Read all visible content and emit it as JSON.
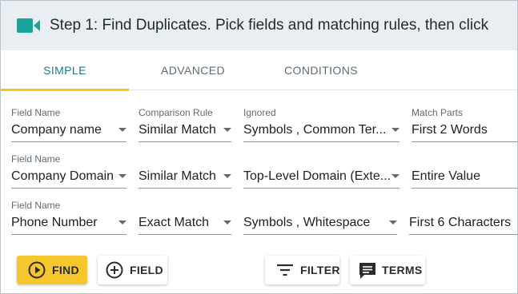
{
  "header": {
    "title": "Step 1: Find Duplicates. Pick fields and matching rules, then click",
    "icon": "video-camera-icon",
    "icon_color": "#1aa39a"
  },
  "tabs": [
    {
      "label": "SIMPLE",
      "active": true
    },
    {
      "label": "ADVANCED",
      "active": false
    },
    {
      "label": "CONDITIONS",
      "active": false
    }
  ],
  "rows": [
    {
      "field_label": "Field Name",
      "field_value": "Company name",
      "rule_label": "Comparison Rule",
      "rule_value": "Similar Match",
      "ignored_label": "Ignored",
      "ignored_value": "Symbols , Common Ter...",
      "parts_label": "Match Parts",
      "parts_value": "First 2 Words"
    },
    {
      "field_label": "Field Name",
      "field_value": "Company Domain",
      "rule_label": "",
      "rule_value": "Similar Match",
      "ignored_label": "",
      "ignored_value": "Top-Level Domain (Exte...",
      "parts_label": "",
      "parts_value": "Entire Value"
    },
    {
      "field_label": "Field Name",
      "field_value": "Phone Number",
      "rule_label": "",
      "rule_value": "Exact Match",
      "ignored_label": "",
      "ignored_value": "Symbols , Whitespace",
      "parts_label": "",
      "parts_value": "First 6 Characters"
    }
  ],
  "buttons": {
    "find": "FIND",
    "field": "FIELD",
    "filter": "FILTER",
    "terms": "TERMS"
  },
  "colors": {
    "accent": "#f5c72c",
    "tab_active": "#1f7a8c",
    "header_bg": "#e8eef2"
  }
}
